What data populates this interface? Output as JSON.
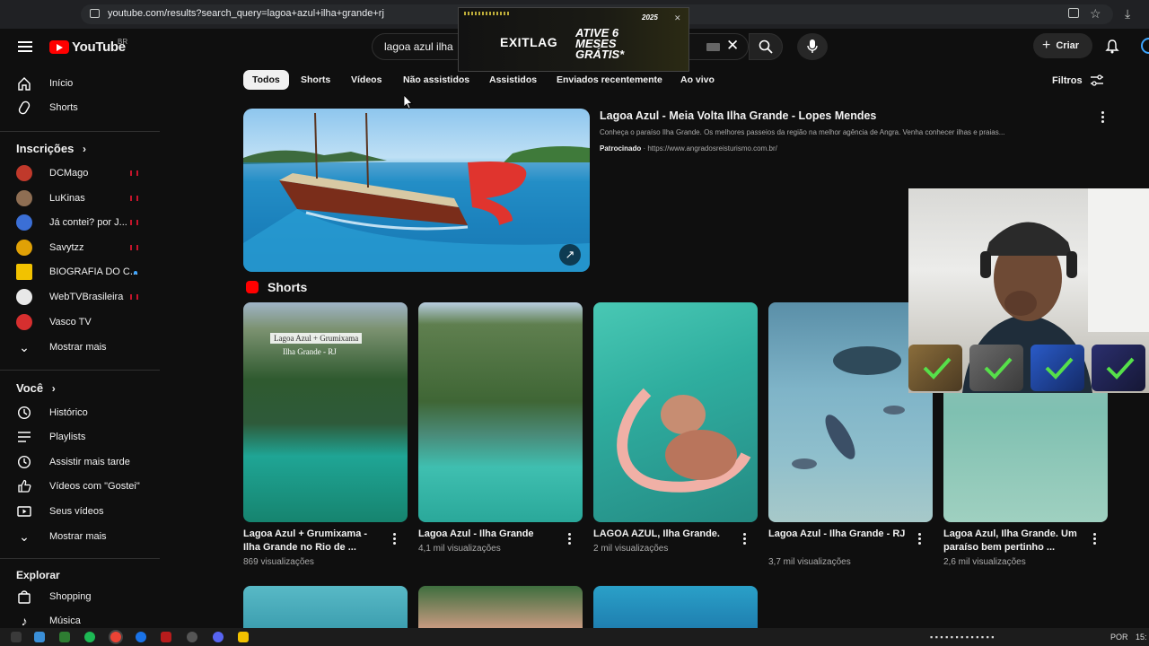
{
  "browser": {
    "url": "youtube.com/results?search_query=lagoa+azul+ilha+grande+rj"
  },
  "header": {
    "logo_text": "YouTube",
    "region": "BR",
    "search_value": "lagoa azul ilha",
    "create_label": "Criar"
  },
  "ad_overlay": {
    "brand": "EXITLAG",
    "promo": "ATIVE 6 MESES GRÁTIS*",
    "year_badge": "2025"
  },
  "sidebar": {
    "main": [
      {
        "label": "Início",
        "icon": "home-icon"
      },
      {
        "label": "Shorts",
        "icon": "shorts-icon"
      }
    ],
    "subscriptions_title": "Inscrições",
    "subscriptions": [
      {
        "label": "DCMago",
        "indicator": "live",
        "color": "#c0392b"
      },
      {
        "label": "LuKinas",
        "indicator": "live",
        "color": "#8e6e53"
      },
      {
        "label": "Já contei? por J...",
        "indicator": "live",
        "color": "#3b6fd6"
      },
      {
        "label": "Savytzz",
        "indicator": "live",
        "color": "#e0a106"
      },
      {
        "label": "BIOGRAFIA DO C...",
        "indicator": "dot",
        "color": "#f2c200"
      },
      {
        "label": "WebTVBrasileira",
        "indicator": "live",
        "color": "#e8e8e8"
      },
      {
        "label": "Vasco TV",
        "indicator": "none",
        "color": "#d62f2f"
      }
    ],
    "show_more_1": "Mostrar mais",
    "you_title": "Você",
    "you": [
      {
        "label": "Histórico",
        "icon": "history-icon"
      },
      {
        "label": "Playlists",
        "icon": "playlists-icon"
      },
      {
        "label": "Assistir mais tarde",
        "icon": "watch-later-icon"
      },
      {
        "label": "Vídeos com \"Gostei\"",
        "icon": "like-icon"
      },
      {
        "label": "Seus vídeos",
        "icon": "your-videos-icon"
      }
    ],
    "show_more_2": "Mostrar mais",
    "explore_title": "Explorar",
    "explore": [
      {
        "label": "Shopping",
        "icon": "shopping-icon"
      },
      {
        "label": "Música",
        "icon": "music-icon"
      }
    ]
  },
  "chips": [
    "Todos",
    "Shorts",
    "Vídeos",
    "Não assistidos",
    "Assistidos",
    "Enviados recentemente",
    "Ao vivo"
  ],
  "filters_label": "Filtros",
  "sponsored": {
    "title": "Lagoa Azul - Meia Volta Ilha Grande - Lopes Mendes",
    "description": "Conheça o paraíso Ilha Grande. Os melhores passeios da região na melhor agência de Angra. Venha conhecer ilhas e praias...",
    "sponsored_label": "Patrocinado",
    "link": "https://www.angradosreisturismo.com.br/"
  },
  "shorts_section": {
    "title": "Shorts",
    "items": [
      {
        "title": "Lagoa Azul + Grumixama - Ilha Grande no Rio de ...",
        "views": "869 visualizações",
        "overlay": "Lagoa Azul + Grumixama",
        "overlay2": "Ilha Grande - RJ"
      },
      {
        "title": "Lagoa Azul - Ilha Grande",
        "views": "4,1 mil visualizações"
      },
      {
        "title": "LAGOA AZUL, Ilha Grande.",
        "views": "2 mil visualizações"
      },
      {
        "title": "Lagoa Azul - Ilha Grande - RJ",
        "views": "3,7 mil visualizações"
      },
      {
        "title": "Lagoa Azul, Ilha Grande. Um paraíso bem pertinho ...",
        "views": "2,6 mil visualizações"
      }
    ]
  },
  "taskbar": {
    "lang": "POR",
    "time": "15:"
  }
}
